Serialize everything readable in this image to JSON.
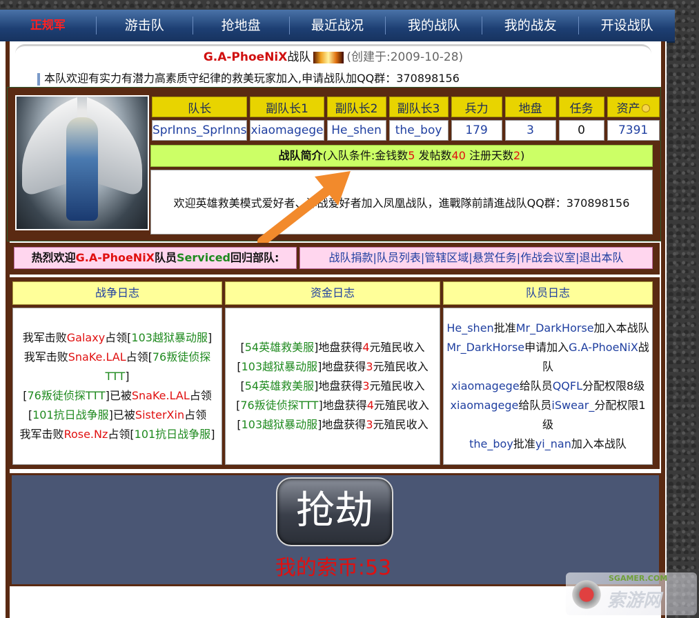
{
  "nav": {
    "items": [
      "正规军",
      "游击队",
      "抢地盘",
      "最近战况",
      "我的战队",
      "我的战友",
      "开设战队"
    ]
  },
  "header": {
    "team_name": "G.A-PhoeNiX",
    "team_suffix": "战队",
    "created": "(创建于:2009-10-28)",
    "notice": "本队欢迎有实力有潜力高素质守纪律的救美玩家加入,申请战队加QQ群：370898156"
  },
  "stats": {
    "headers": [
      "队长",
      "副队长1",
      "副队长2",
      "副队长3",
      "兵力",
      "地盘",
      "任务",
      "资产"
    ],
    "values": [
      "SprInns_SprInns",
      "xiaomagege",
      "He_shen",
      "the_boy",
      "179",
      "3",
      "0",
      "7391"
    ]
  },
  "intro": {
    "label": "战队简介",
    "cond_open": "(入队条件:金钱数",
    "money": "5",
    "posts_label": " 发帖数",
    "posts": "40",
    "days_label": " 注册天数",
    "days": "2",
    "cond_close": ")",
    "text": "欢迎英雄救美模式爱好者、浑战爱好者加入凤凰战队，進戰隊前請進战队QQ群：370898156"
  },
  "welcome": {
    "prefix": "热烈欢迎",
    "team": "G.A-PhoeNiX",
    "member_label": "队员",
    "member": "Serviced",
    "suffix": "回归部队:",
    "links": [
      "战队捐款",
      "队员列表",
      "管辖区域",
      "悬赏任务",
      "作战会议室",
      "退出本队"
    ]
  },
  "logs": {
    "war": {
      "title": "战争日志",
      "lines": [
        [
          "我军击败",
          "Galaxy",
          "占领[",
          "103越狱暴动服",
          "]"
        ],
        [
          "我军击败",
          "SnaKe.LAL",
          "占领[",
          "76叛徒侦探TTT",
          "]"
        ],
        [
          "[",
          "76叛徒侦探TTT",
          "]已被",
          "SnaKe.LAL",
          "占领"
        ],
        [
          "[",
          "101抗日战争服",
          "]已被",
          "SisterXin",
          "占领"
        ],
        [
          "我军击败",
          "Rose.Nz",
          "占领[",
          "101抗日战争服",
          "]"
        ]
      ]
    },
    "fund": {
      "title": "资金日志",
      "lines": [
        [
          "[",
          "54英雄救美服",
          "]地盘获得",
          "4",
          "元殖民收入"
        ],
        [
          "[",
          "103越狱暴动服",
          "]地盘获得",
          "3",
          "元殖民收入"
        ],
        [
          "[",
          "54英雄救美服",
          "]地盘获得",
          "3",
          "元殖民收入"
        ],
        [
          "[",
          "76叛徒侦探TTT",
          "]地盘获得",
          "4",
          "元殖民收入"
        ],
        [
          "[",
          "103越狱暴动服",
          "]地盘获得",
          "3",
          "元殖民收入"
        ]
      ]
    },
    "member": {
      "title": "队员日志",
      "lines": [
        [
          "He_shen",
          "批准",
          "Mr_DarkHorse",
          "加入本战队"
        ],
        [
          "Mr_DarkHorse",
          "申请加入",
          "G.A-PhoeNiX",
          "战队"
        ],
        [
          "xiaomagege",
          "给队员",
          "QQFL",
          "分配权限8级"
        ],
        [
          "xiaomagege",
          "给队员",
          "iSwear_",
          "分配权限1级"
        ],
        [
          "the_boy",
          "批准",
          "yi_nan",
          "加入本战队"
        ]
      ]
    }
  },
  "rob": {
    "button": "抢劫",
    "coins": "我的索币:53"
  },
  "watermark": {
    "site": "SGAMER.COM",
    "brand": "索游网"
  },
  "colors": {
    "nav_bg": "#1d3f73",
    "frame_brown": "#5a2a12",
    "header_yellow": "#e8d400",
    "intro_green": "#ccff66",
    "welcome_pink": "#ffd6ee",
    "log_head_yellow": "#ffff99",
    "rob_panel": "#4a5674",
    "link_blue": "#1f3fa0",
    "alert_red": "#e01010",
    "server_green": "#1f8a1f"
  }
}
